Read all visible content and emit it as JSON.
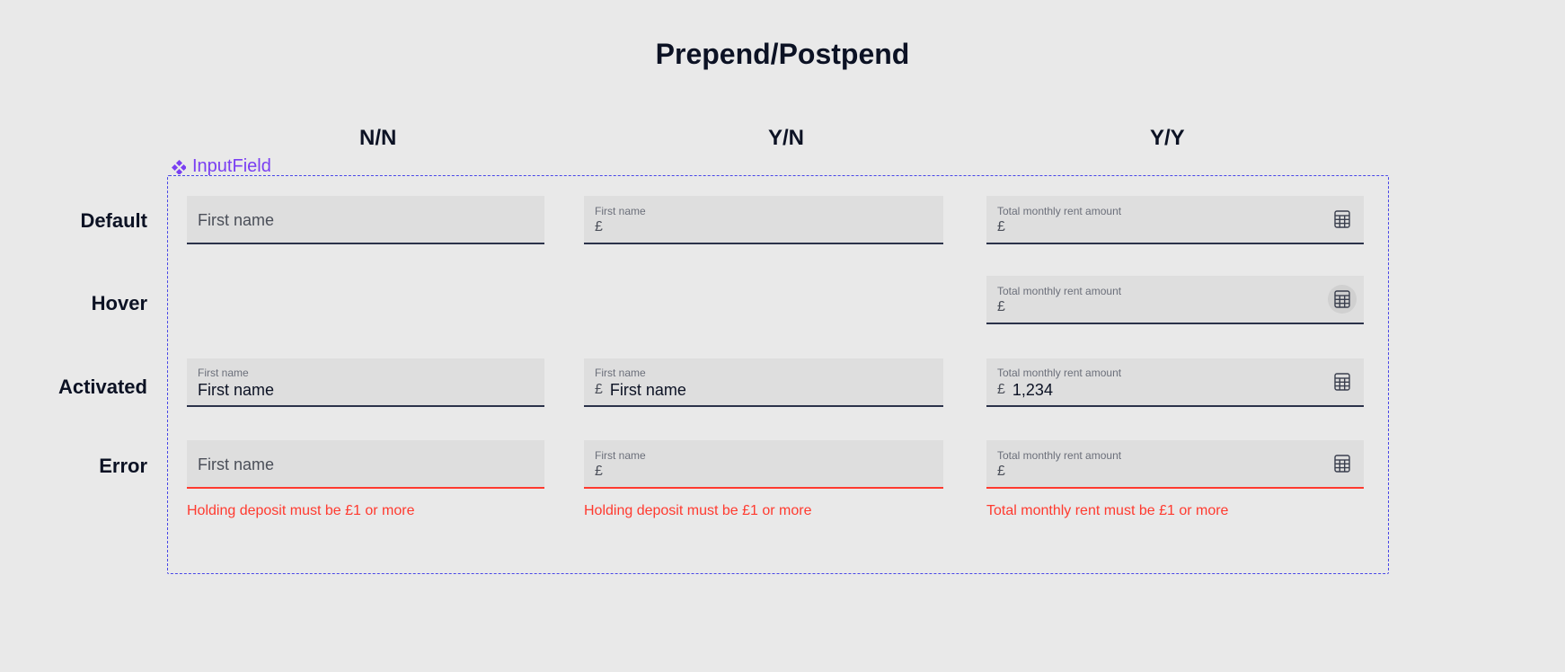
{
  "title": "Prepend/Postpend",
  "component_name": "InputField",
  "columns": {
    "nn": "N/N",
    "yn": "Y/N",
    "yy": "Y/Y"
  },
  "rows": {
    "default": "Default",
    "hover": "Hover",
    "activated": "Activated",
    "error": "Error"
  },
  "labels": {
    "first_name": "First name",
    "rent": "Total monthly rent amount"
  },
  "placeholders": {
    "first_name": "First name"
  },
  "prepend": {
    "pound": "£"
  },
  "values": {
    "activated_firstname": "First name",
    "activated_rent": "1,234"
  },
  "errors": {
    "holding": "Holding deposit must be £1 or more",
    "rent": "Total monthly rent must be £1 or more"
  }
}
